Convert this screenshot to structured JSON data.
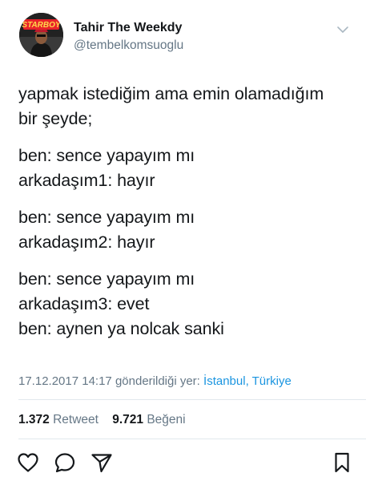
{
  "author": {
    "name": "Tahir The Weekdy",
    "handle": "@tembelkomsuoglu",
    "avatar_badge_text": "STARBOY"
  },
  "tweet": {
    "paragraphs": [
      [
        "yapmak istediğim ama emin olamadığım",
        "bir şeyde;"
      ],
      [
        "ben: sence yapayım mı",
        "arkadaşım1: hayır"
      ],
      [
        "ben: sence yapayım mı",
        "arkadaşım2: hayır"
      ],
      [
        "ben: sence yapayım mı",
        "arkadaşım3: evet",
        "ben: aynen ya nolcak sanki"
      ]
    ]
  },
  "meta": {
    "timestamp": "17.12.2017 14:17",
    "sent_from_label": "gönderildiği yer:",
    "location": "İstanbul, Türkiye"
  },
  "stats": {
    "retweets_count": "1.372",
    "retweets_label": "Retweet",
    "likes_count": "9.721",
    "likes_label": "Beğeni"
  },
  "icons": {
    "options": "chevron-down-icon",
    "like": "heart-icon",
    "reply": "comment-bubble-icon",
    "share": "paper-plane-icon",
    "bookmark": "bookmark-icon"
  },
  "colors": {
    "text": "#14171a",
    "secondary": "#657786",
    "link": "#1b95e0",
    "divider": "#e1e8ed",
    "avatar_badge": "#e8232a"
  }
}
